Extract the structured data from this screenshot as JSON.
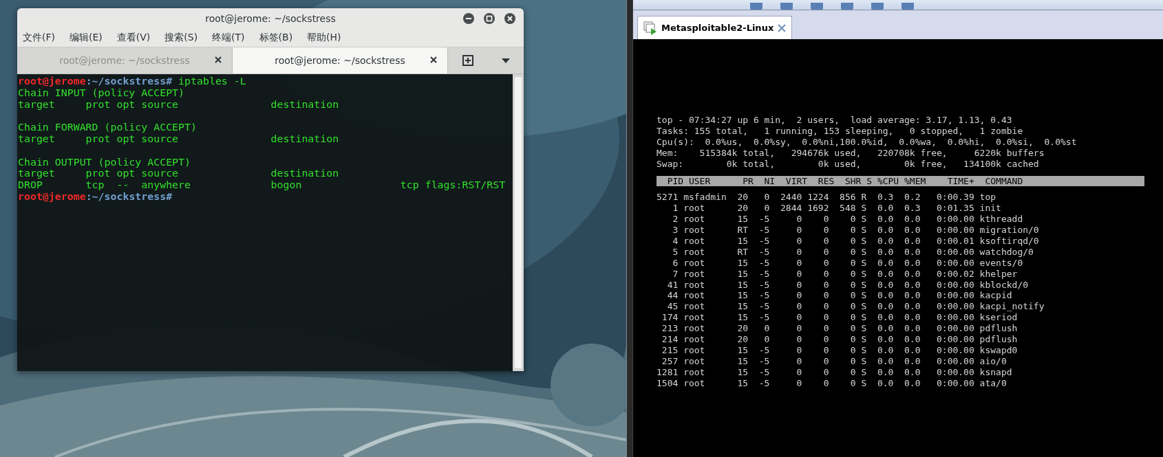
{
  "terminal": {
    "title": "root@jerome: ~/sockstress",
    "menu": [
      "文件(F)",
      "编辑(E)",
      "查看(V)",
      "搜索(S)",
      "终端(T)",
      "标签(B)",
      "帮助(H)"
    ],
    "tabs": [
      {
        "label": "root@jerome: ~/sockstress",
        "selected": false
      },
      {
        "label": "root@jerome: ~/sockstress",
        "selected": true
      }
    ],
    "lines": [
      {
        "kind": "prompt",
        "user": "root@jerome",
        "path": ":~/sockstress#",
        "command": " iptables -L"
      },
      {
        "kind": "output",
        "text": "Chain INPUT (policy ACCEPT)"
      },
      {
        "kind": "output",
        "text": "target     prot opt source               destination"
      },
      {
        "kind": "blank"
      },
      {
        "kind": "output",
        "text": "Chain FORWARD (policy ACCEPT)"
      },
      {
        "kind": "output",
        "text": "target     prot opt source               destination"
      },
      {
        "kind": "blank"
      },
      {
        "kind": "output",
        "text": "Chain OUTPUT (policy ACCEPT)"
      },
      {
        "kind": "output",
        "text": "target     prot opt source               destination"
      },
      {
        "kind": "output",
        "text": "DROP       tcp  --  anywhere             bogon                tcp flags:RST/RST"
      },
      {
        "kind": "prompt",
        "user": "root@jerome",
        "path": ":~/sockstress#"
      }
    ]
  },
  "vm": {
    "tab": {
      "label": "Metasploitable2-Linux",
      "selected": true
    },
    "summary": [
      "top - 07:34:27 up 6 min,  2 users,  load average: 3.17, 1.13, 0.43",
      "Tasks: 155 total,   1 running, 153 sleeping,   0 stopped,   1 zombie",
      "Cpu(s):  0.0%us,  0.0%sy,  0.0%ni,100.0%id,  0.0%wa,  0.0%hi,  0.0%si,  0.0%st",
      "Mem:    515384k total,   294676k used,   220708k free,     6220k buffers",
      "Swap:        0k total,        0k used,        0k free,   134100k cached"
    ],
    "header": "  PID USER      PR  NI  VIRT  RES  SHR S %CPU %MEM    TIME+  COMMAND",
    "rows": [
      "5271 msfadmin  20   0  2440 1224  856 R  0.3  0.2   0:00.39 top",
      "   1 root      20   0  2844 1692  548 S  0.0  0.3   0:01.35 init",
      "   2 root      15  -5     0    0    0 S  0.0  0.0   0:00.00 kthreadd",
      "   3 root      RT  -5     0    0    0 S  0.0  0.0   0:00.00 migration/0",
      "   4 root      15  -5     0    0    0 S  0.0  0.0   0:00.01 ksoftirqd/0",
      "   5 root      RT  -5     0    0    0 S  0.0  0.0   0:00.00 watchdog/0",
      "   6 root      15  -5     0    0    0 S  0.0  0.0   0:00.00 events/0",
      "   7 root      15  -5     0    0    0 S  0.0  0.0   0:00.02 khelper",
      "  41 root      15  -5     0    0    0 S  0.0  0.0   0:00.00 kblockd/0",
      "  44 root      15  -5     0    0    0 S  0.0  0.0   0:00.00 kacpid",
      "  45 root      15  -5     0    0    0 S  0.0  0.0   0:00.00 kacpi_notify",
      " 174 root      15  -5     0    0    0 S  0.0  0.0   0:00.00 kseriod",
      " 213 root      20   0     0    0    0 S  0.0  0.0   0:00.00 pdflush",
      " 214 root      20   0     0    0    0 S  0.0  0.0   0:00.00 pdflush",
      " 215 root      15  -5     0    0    0 S  0.0  0.0   0:00.00 kswapd0",
      " 257 root      15  -5     0    0    0 S  0.0  0.0   0:00.00 aio/0",
      "1281 root      15  -5     0    0    0 S  0.0  0.0   0:00.00 ksnapd",
      "1504 root      15  -5     0    0    0 S  0.0  0.0   0:00.00 ata/0"
    ]
  }
}
